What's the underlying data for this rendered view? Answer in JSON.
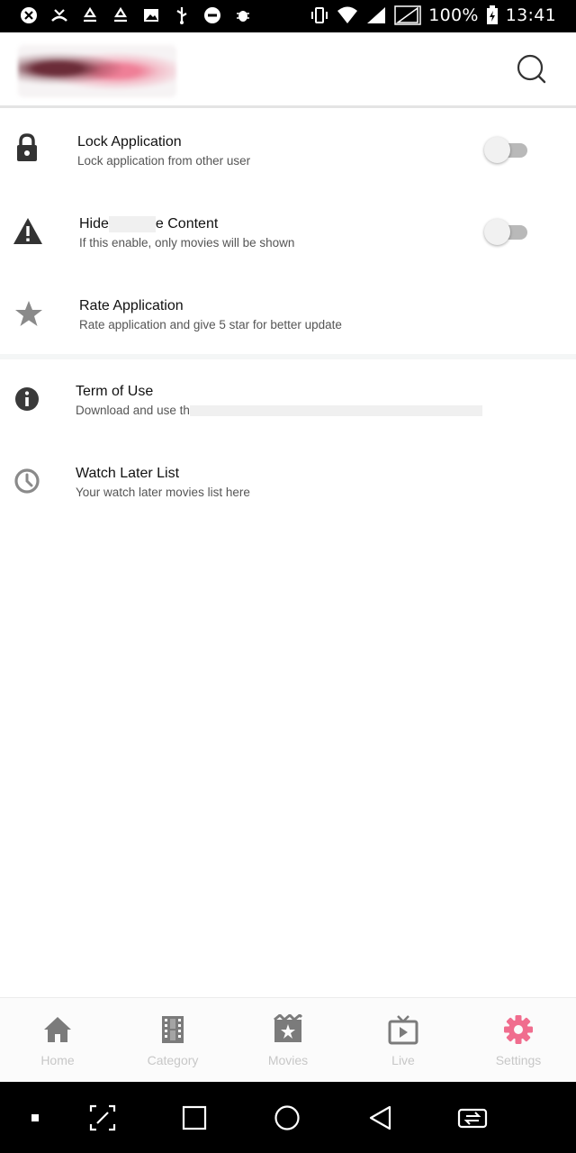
{
  "status_bar": {
    "icons": [
      "ribbon-icon",
      "missed-call-icon",
      "recycle-icon",
      "recycle-icon",
      "image-icon",
      "usb-icon",
      "do-not-disturb-icon",
      "bug-icon"
    ],
    "right_icons": [
      "vibrate-icon",
      "wifi-icon",
      "signal-icon",
      "signal-x-icon",
      "battery-charging-icon"
    ],
    "battery_text": "100%",
    "time": "13:41"
  },
  "app_bar": {
    "logo": "app-logo",
    "search_icon": "search-icon"
  },
  "settings": {
    "lock": {
      "icon": "lock-icon",
      "title": "Lock Application",
      "subtitle": "Lock application from other user",
      "toggle_on": false
    },
    "hide": {
      "icon": "warning-icon",
      "title_start": "Hide",
      "title_end": "e Content",
      "subtitle": "If this enable, only movies will be shown",
      "toggle_on": false
    },
    "rate": {
      "icon": "star-icon",
      "title": "Rate Application",
      "subtitle": "Rate application and give 5 star for better update"
    },
    "terms": {
      "icon": "info-icon",
      "title": "Term of Use",
      "subtitle": "Download and use th"
    },
    "watch_later": {
      "icon": "clock-icon",
      "title": "Watch Later List",
      "subtitle": "Your watch later movies list here"
    }
  },
  "bottom_nav": {
    "items": [
      {
        "label": "Home",
        "icon": "home-icon"
      },
      {
        "label": "Category",
        "icon": "film-strip-icon"
      },
      {
        "label": "Movies",
        "icon": "movie-clapper-icon"
      },
      {
        "label": "Live",
        "icon": "tv-icon"
      },
      {
        "label": "Settings",
        "icon": "gear-icon"
      }
    ],
    "active_color": "#f06d8e",
    "icon_color": "#7b7b7b",
    "label_color": "#c7c7c7"
  },
  "system_nav": [
    "dot-icon",
    "screenshot-icon",
    "recents-icon",
    "home-circle-icon",
    "back-icon",
    "switch-app-icon"
  ]
}
